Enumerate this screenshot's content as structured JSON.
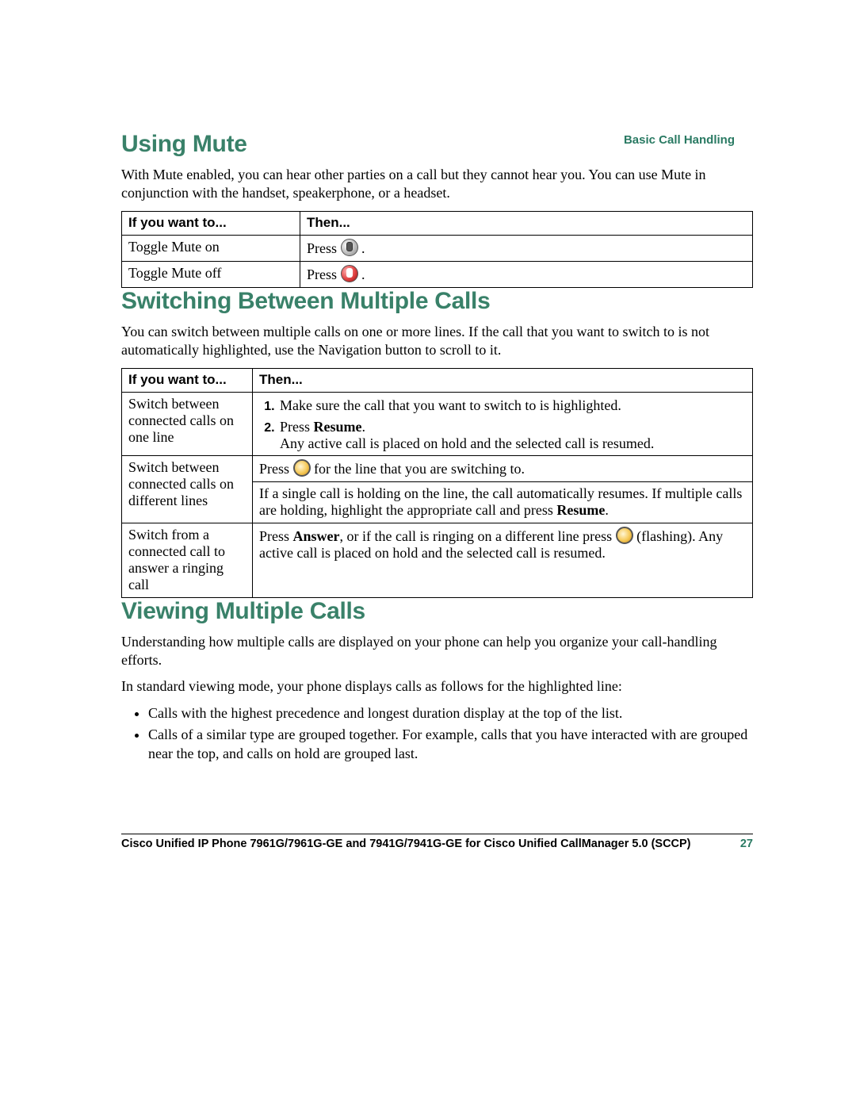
{
  "running_header": "Basic Call Handling",
  "mute": {
    "heading": "Using Mute",
    "intro": "With Mute enabled, you can hear other parties on a call but they cannot hear you. You can use Mute in conjunction with the handset, speakerphone, or a headset.",
    "col_if": "If you want to...",
    "col_then": "Then...",
    "rows": [
      {
        "if": "Toggle Mute on",
        "then_prefix": "Press ",
        "then_icon": "mute-button-off-icon",
        "then_suffix": "."
      },
      {
        "if": "Toggle Mute off",
        "then_prefix": "Press ",
        "then_icon": "mute-button-on-icon",
        "then_suffix": "."
      }
    ]
  },
  "switch": {
    "heading": "Switching Between Multiple Calls",
    "intro": "You can switch between multiple calls on one or more lines. If the call that you want to switch to is not automatically highlighted, use the Navigation button to scroll to it.",
    "col_if": "If you want to...",
    "col_then": "Then...",
    "rows": [
      {
        "if": "Switch between connected calls on one line",
        "step1": "Make sure the call that you want to switch to is highlighted.",
        "step2_prefix": "Press ",
        "step2_bold": "Resume",
        "step2_suffix": ".",
        "step2_tail": "Any active call is placed on hold and the selected call is resumed."
      },
      {
        "if": "Switch between connected calls on different lines",
        "top_prefix": "Press ",
        "top_icon": "line-button-icon",
        "top_suffix": " for the line that you are switching to.",
        "rest_a": "If a single call is holding on the line, the call automatically resumes. If multiple calls are holding, highlight the appropriate call and press ",
        "rest_bold": "Resume",
        "rest_b": "."
      },
      {
        "if": "Switch from a connected call to answer a ringing call",
        "a": "Press ",
        "a_bold": "Answer",
        "b": ", or if the call is ringing on a different line press ",
        "b_icon": "line-button-flashing-icon",
        "c": " (flashing). Any active call is placed on hold and the selected call is resumed."
      }
    ]
  },
  "view": {
    "heading": "Viewing Multiple Calls",
    "p1": "Understanding how multiple calls are displayed on your phone can help you organize your call-handling efforts.",
    "p2": "In standard viewing mode, your phone displays calls as follows for the highlighted line:",
    "bullets": [
      "Calls with the highest precedence and longest duration display at the top of the list.",
      "Calls of a similar type are grouped together. For example, calls that you have interacted with are grouped near the top, and calls on hold are grouped last."
    ]
  },
  "footer": {
    "title": "Cisco Unified IP Phone 7961G/7961G-GE and 7941G/7941G-GE for Cisco Unified CallManager 5.0 (SCCP)",
    "page": "27"
  }
}
